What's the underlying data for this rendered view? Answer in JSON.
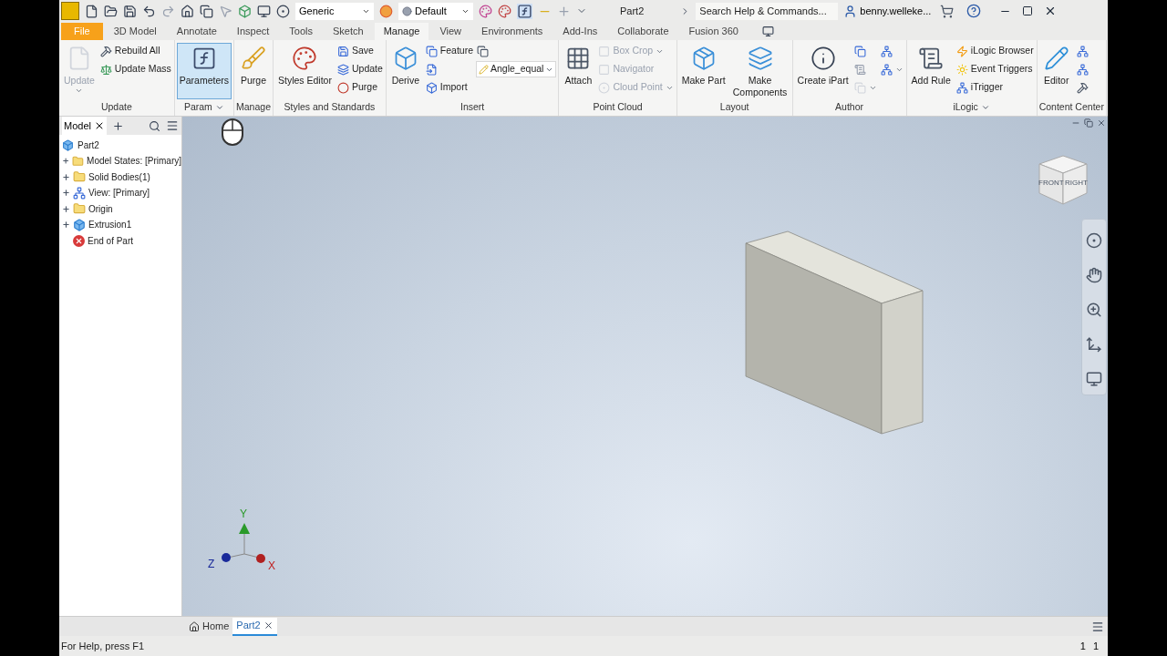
{
  "title_bar": {
    "style": "Generic",
    "appearance": "Default",
    "document": "Part2",
    "search": {
      "placeholder": "Search Help & Commands..."
    },
    "user": "benny.welleke..."
  },
  "tabs": [
    {
      "label": "File",
      "kind": "file",
      "selected": false
    },
    {
      "label": "3D Model",
      "kind": "tab",
      "selected": false
    },
    {
      "label": "Annotate",
      "kind": "tab",
      "selected": false
    },
    {
      "label": "Inspect",
      "kind": "tab",
      "selected": false
    },
    {
      "label": "Tools",
      "kind": "tab",
      "selected": false
    },
    {
      "label": "Sketch",
      "kind": "tab",
      "selected": false
    },
    {
      "label": "Manage",
      "kind": "tab",
      "selected": true
    },
    {
      "label": "View",
      "kind": "tab",
      "selected": false
    },
    {
      "label": "Environments",
      "kind": "tab",
      "selected": false
    },
    {
      "label": "Add-Ins",
      "kind": "tab",
      "selected": false
    },
    {
      "label": "Collaborate",
      "kind": "tab",
      "selected": false
    },
    {
      "label": "Fusion 360",
      "kind": "tab",
      "selected": false
    }
  ],
  "ribbon": [
    {
      "title": "Update",
      "menu": false,
      "items": [
        {
          "kind": "large",
          "label": "Update",
          "disabled": true,
          "menu": true,
          "highlighted": false
        },
        {
          "kind": "stack",
          "tools": [
            {
              "label": "Rebuild All",
              "disabled": false,
              "menu": false
            },
            {
              "label": "Update Mass",
              "disabled": false,
              "menu": false
            }
          ]
        }
      ]
    },
    {
      "title": "Param",
      "menu": true,
      "items": [
        {
          "kind": "large",
          "label": "Parameters",
          "disabled": false,
          "menu": false,
          "highlighted": true
        }
      ]
    },
    {
      "title": "Manage",
      "menu": false,
      "items": [
        {
          "kind": "large",
          "label": "Purge",
          "disabled": false,
          "menu": false,
          "highlighted": false
        }
      ]
    },
    {
      "title": "Styles and Standards",
      "menu": false,
      "items": [
        {
          "kind": "large",
          "label": "Styles Editor",
          "disabled": false,
          "menu": false,
          "highlighted": false
        },
        {
          "kind": "stack",
          "tools": [
            {
              "label": "Save",
              "disabled": false,
              "menu": false
            },
            {
              "label": "Update",
              "disabled": false,
              "menu": false
            },
            {
              "label": "Purge",
              "disabled": false,
              "menu": false
            }
          ]
        }
      ]
    },
    {
      "title": "Insert",
      "menu": false,
      "items": [
        {
          "kind": "large",
          "label": "Derive",
          "disabled": false,
          "menu": false,
          "highlighted": false
        },
        {
          "kind": "stack",
          "tools": [
            {
              "label": "Feature",
              "disabled": false,
              "menu": false
            },
            {
              "disabled": false,
              "menu": false
            },
            {
              "label": "Import",
              "disabled": false,
              "menu": false
            }
          ]
        },
        {
          "kind": "stack",
          "tools": [
            {
              "disabled": false,
              "menu": false
            },
            {
              "label": "Angle_equal",
              "kind": "combo",
              "disabled": false,
              "menu": true
            }
          ]
        }
      ]
    },
    {
      "title": "Point Cloud",
      "menu": false,
      "items": [
        {
          "kind": "large",
          "label": "Attach",
          "disabled": false,
          "menu": false,
          "highlighted": false
        },
        {
          "kind": "stack",
          "tools": [
            {
              "label": "Box Crop",
              "disabled": true,
              "menu": true
            },
            {
              "label": "Navigator",
              "disabled": true,
              "menu": false
            },
            {
              "label": "Cloud Point",
              "disabled": true,
              "menu": true
            }
          ]
        }
      ]
    },
    {
      "title": "Layout",
      "menu": false,
      "items": [
        {
          "kind": "large",
          "label": "Make Part",
          "disabled": false,
          "menu": false,
          "highlighted": false
        },
        {
          "kind": "large",
          "label": "Make Components",
          "disabled": false,
          "menu": false,
          "highlighted": false
        }
      ]
    },
    {
      "title": "Author",
      "menu": false,
      "items": [
        {
          "kind": "large",
          "label": "Create iPart",
          "disabled": false,
          "menu": false,
          "highlighted": false
        },
        {
          "kind": "stack",
          "tools": [
            {
              "disabled": false,
              "menu": false
            },
            {
              "disabled": false,
              "menu": false
            },
            {
              "disabled": true,
              "menu": true
            }
          ]
        },
        {
          "kind": "stack",
          "tools": [
            {
              "disabled": false,
              "menu": false
            },
            {
              "disabled": false,
              "menu": true
            }
          ]
        }
      ]
    },
    {
      "title": "iLogic",
      "menu": true,
      "items": [
        {
          "kind": "large",
          "label": "Add Rule",
          "disabled": false,
          "menu": false,
          "highlighted": false
        },
        {
          "kind": "stack",
          "tools": [
            {
              "label": "iLogic Browser",
              "disabled": false,
              "menu": false
            },
            {
              "label": "Event Triggers",
              "disabled": false,
              "menu": false
            },
            {
              "label": "iTrigger",
              "disabled": false,
              "menu": false
            }
          ]
        }
      ]
    },
    {
      "title": "Content Center",
      "menu": false,
      "items": [
        {
          "kind": "large",
          "label": "Editor",
          "disabled": false,
          "menu": false,
          "highlighted": false
        },
        {
          "kind": "stack",
          "tools": [
            {
              "disabled": false,
              "menu": false
            },
            {
              "disabled": false,
              "menu": false
            },
            {
              "disabled": false,
              "menu": false
            }
          ]
        }
      ]
    }
  ],
  "browser": {
    "tab": "Model",
    "tree": {
      "label": "Part2",
      "children": [
        {
          "label": "Model States: [Primary]",
          "kind": "folder",
          "expanded": false
        },
        {
          "label": "Solid Bodies(1)",
          "kind": "bodies",
          "expanded": false
        },
        {
          "label": "View: [Primary]",
          "kind": "view",
          "expanded": false
        },
        {
          "label": "Origin",
          "kind": "folder",
          "expanded": false
        },
        {
          "label": "Extrusion1",
          "kind": "extrusion",
          "expanded": false
        },
        {
          "label": "End of Part",
          "kind": "end"
        }
      ]
    }
  },
  "viewport": {
    "viewcube": [
      "FRONT",
      "RIGHT"
    ],
    "axes": {
      "y": "Y",
      "z": "Z",
      "x": "X"
    }
  },
  "doc_tabs": [
    {
      "label": "Home",
      "kind": "home",
      "selected": false
    },
    {
      "label": "Part2",
      "kind": "doc",
      "selected": true
    }
  ],
  "status_bar": {
    "message": "For Help, press F1",
    "values": [
      "1",
      "1"
    ]
  }
}
